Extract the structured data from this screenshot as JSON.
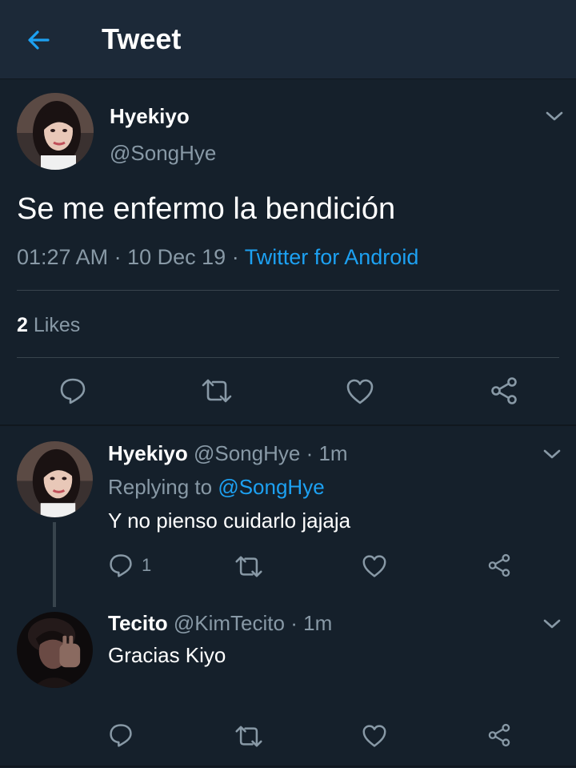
{
  "header": {
    "title": "Tweet",
    "back_icon": "arrow-left-icon"
  },
  "colors": {
    "background": "#15202b",
    "header": "#1c2938",
    "accent": "#1da1f2",
    "muted": "#8899a6",
    "divider": "#38444d"
  },
  "main_tweet": {
    "name": "Hyekiyo",
    "handle": "@SongHye",
    "text": "Se me enfermo la bendición",
    "time": "01:27 AM",
    "date": "10 Dec 19",
    "separator": "·",
    "source": "Twitter for Android",
    "likes_count": "2",
    "likes_label": "Likes"
  },
  "replies": [
    {
      "name": "Hyekiyo",
      "handle": "@SongHye",
      "time": "1m",
      "separator": "·",
      "replying_prefix": "Replying to",
      "replying_handle": "@SongHye",
      "text": "Y no pienso cuidarlo jajaja",
      "reply_count": "1"
    },
    {
      "name": "Tecito",
      "handle": "@KimTecito",
      "time": "1m",
      "separator": "·",
      "text": "Gracias Kiyo"
    }
  ]
}
